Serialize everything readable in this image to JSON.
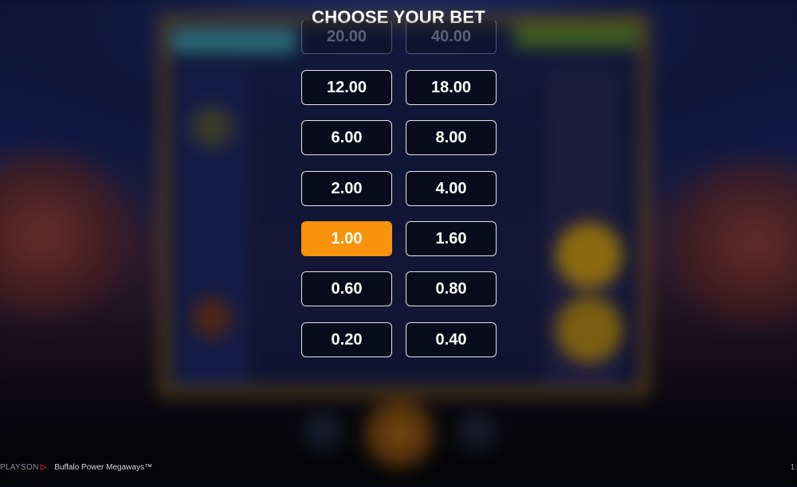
{
  "title": "CHOOSE YOUR BET",
  "bet_options": [
    {
      "left": "20.00",
      "right": "40.00"
    },
    {
      "left": "12.00",
      "right": "18.00"
    },
    {
      "left": "6.00",
      "right": "8.00"
    },
    {
      "left": "2.00",
      "right": "4.00"
    },
    {
      "left": "1.00",
      "right": "1.60"
    },
    {
      "left": "0.60",
      "right": "0.80"
    },
    {
      "left": "0.20",
      "right": "0.40"
    }
  ],
  "selected_bet": "1.00",
  "footer": {
    "provider_logo": "PLAYSON",
    "provider_mark": "▷",
    "game_name": "Buffalo Power Megaways™",
    "corner_text": "1:"
  },
  "colors": {
    "accent_selected": "#f7940b",
    "button_border": "#e6e6ea",
    "brand_mark": "#b71d4b"
  }
}
